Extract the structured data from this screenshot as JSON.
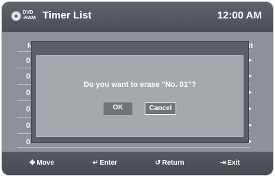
{
  "header": {
    "disc_label_top": "DVD",
    "disc_label_bottom": "-RAM",
    "title": "Timer List",
    "clock": "12:00 AM"
  },
  "list": {
    "col_no": "N",
    "col_edit": "lit",
    "row_numbers": [
      "0",
      "0",
      "0",
      "0",
      "0",
      "0"
    ]
  },
  "dialog": {
    "message": "Do you want to erase \"No. 01\"?",
    "ok_label": "OK",
    "cancel_label": "Cancel"
  },
  "footer": {
    "move_label": "Move",
    "enter_label": "Enter",
    "return_label": "Return",
    "exit_label": "Exit"
  }
}
